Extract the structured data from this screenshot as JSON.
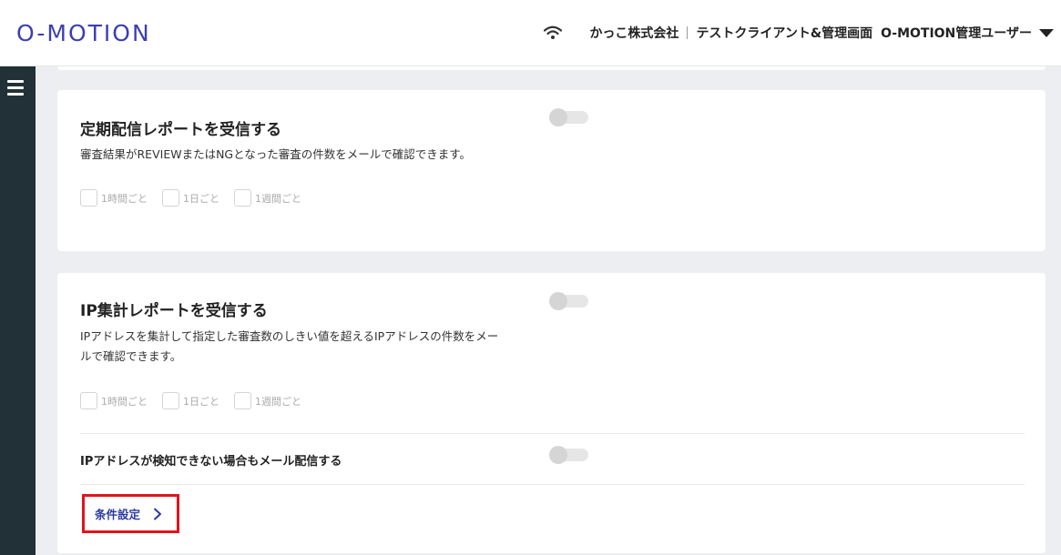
{
  "header": {
    "logo": "O-MOTION",
    "company": "かっこ株式会社",
    "client": "テストクライアント&管理画面",
    "user": "O-MOTION管理ユーザー"
  },
  "icons": {
    "wifi": "wifi-icon",
    "menu": "hamburger-menu-icon",
    "dropdown": "caret-down-icon",
    "chevron": "chevron-right-icon"
  },
  "colors": {
    "brand": "#3b3fb0",
    "sidebar": "#223038",
    "highlight": "#e2131b",
    "link": "#2b3aa0"
  },
  "periodic_report": {
    "title": "定期配信レポートを受信する",
    "description": "審査結果がREVIEWまたはNGとなった審査の件数をメールで確認できます。",
    "enabled": false,
    "options": [
      "1時間ごと",
      "1日ごと",
      "1週間ごと"
    ]
  },
  "ip_report": {
    "title": "IP集計レポートを受信する",
    "description_line1": "IPアドレスを集計して指定した審査数のしきい値を超えるIPアドレスの件数をメー",
    "description_line2": "ルで確認できます。",
    "enabled": false,
    "options": [
      "1時間ごと",
      "1日ごと",
      "1週間ごと"
    ],
    "undetectable_label": "IPアドレスが検知できない場合もメール配信する",
    "undetectable_enabled": false,
    "condition_button": "条件設定"
  }
}
